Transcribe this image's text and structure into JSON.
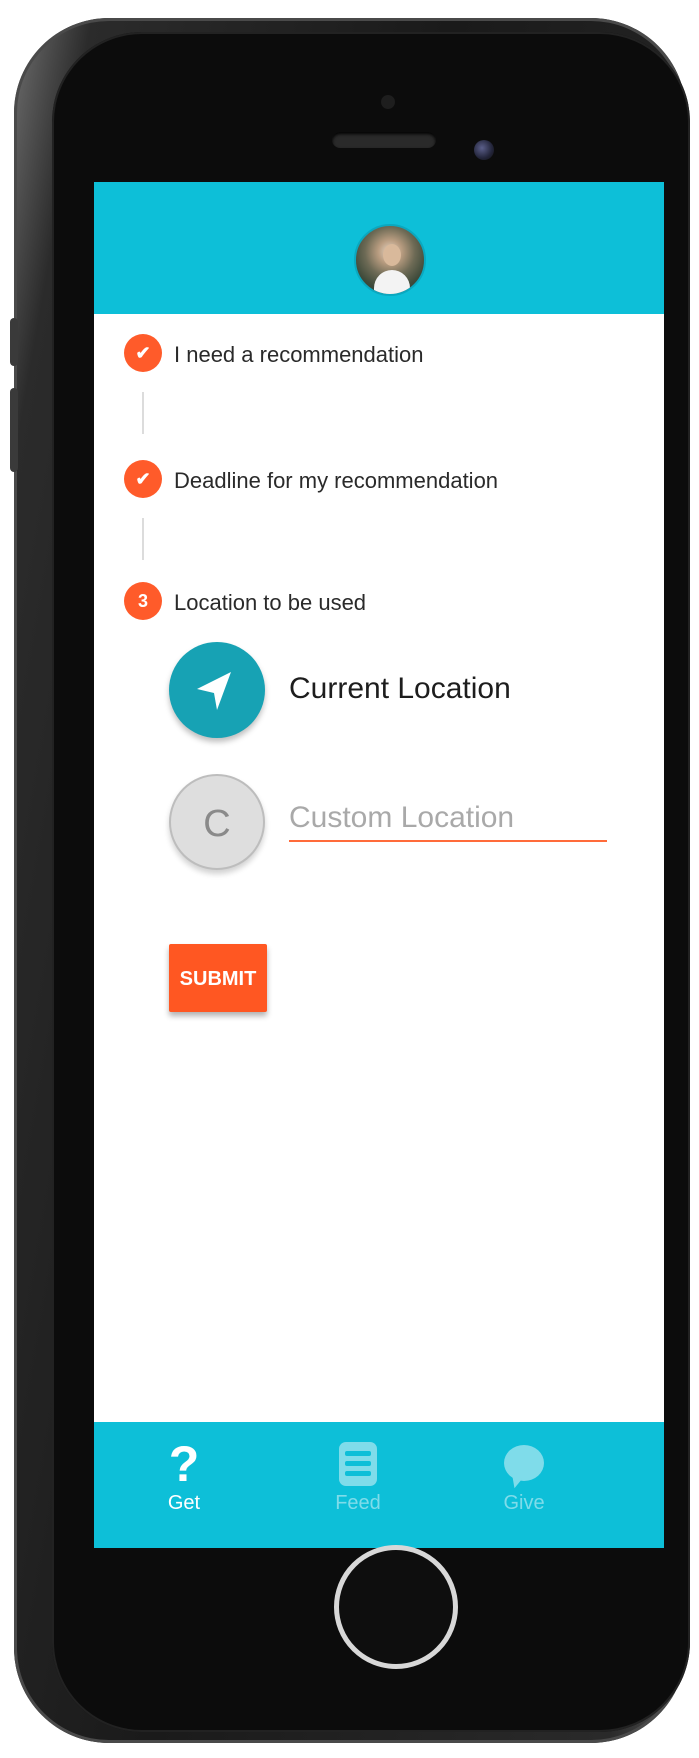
{
  "header": {
    "avatar_alt": "profile photo"
  },
  "steps": [
    {
      "marker": "✔",
      "label": "I need a recommendation",
      "state": "done"
    },
    {
      "marker": "✔",
      "label": "Deadline for my recommendation",
      "state": "done"
    },
    {
      "marker": "3",
      "label": "Location to be used",
      "state": "active"
    }
  ],
  "location": {
    "current_label": "Current Location",
    "current_icon": "navigation-arrow-icon",
    "custom_letter": "C",
    "custom_placeholder": "Custom Location",
    "custom_value": ""
  },
  "submit_label": "SUBMIT",
  "tabbar": {
    "tabs": [
      {
        "label": "Get",
        "icon": "question-mark-icon",
        "glyph": "?",
        "active": true
      },
      {
        "label": "Feed",
        "icon": "list-icon",
        "active": false
      },
      {
        "label": "Give",
        "icon": "chat-bubble-icon",
        "active": false
      }
    ]
  },
  "colors": {
    "primary": "#0dbfd8",
    "accent": "#ff5722",
    "teal_circle": "#17a2b4"
  }
}
